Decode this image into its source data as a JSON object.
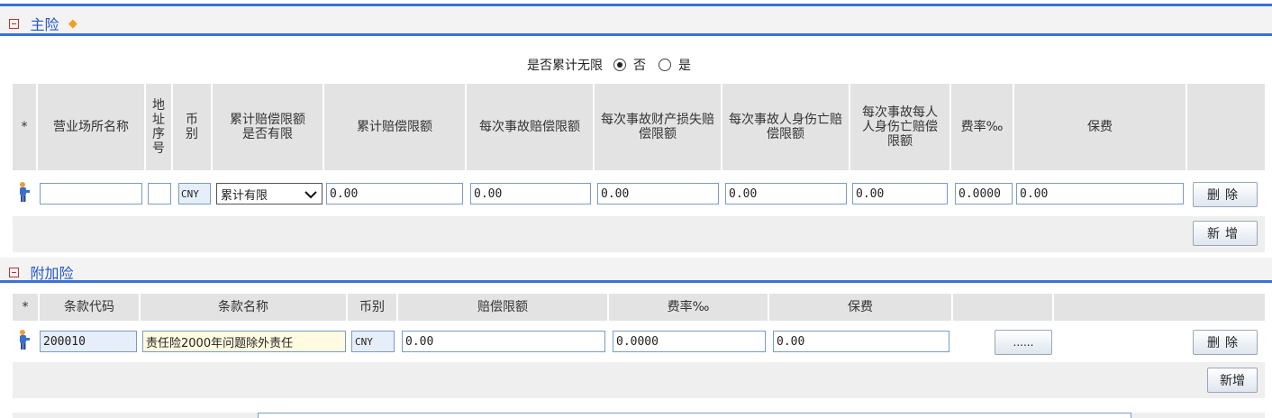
{
  "main": {
    "title": "主险",
    "marker": "◆",
    "cumulative_label": "是否累计无限",
    "radio_no": "否",
    "radio_yes": "是",
    "headers": {
      "star": "*",
      "place_name": "营业场所名称",
      "addr_seq": "地址序号",
      "currency": "币别",
      "cum_limit_flag": "累计赔偿限额是否有限",
      "cum_limit": "累计赔偿限额",
      "per_accident": "每次事故赔偿限额",
      "per_property": "每次事故财产损失赔偿限额",
      "per_injury": "每次事故人身伤亡赔偿限额",
      "per_person": "每次事故每人人身伤亡赔偿限额",
      "rate": "费率‰",
      "premium": "保费"
    },
    "row": {
      "place_name": "",
      "addr_seq": "",
      "currency": "CNY",
      "cum_limit_flag": "累计有限",
      "cum_limit": "0.00",
      "per_accident": "0.00",
      "per_property": "0.00",
      "per_injury": "0.00",
      "per_person": "0.00",
      "rate": "0.0000",
      "premium": "0.00"
    },
    "delete_label": "删除",
    "add_label": "新增"
  },
  "addl": {
    "title": "附加险",
    "headers": {
      "star": "*",
      "clause_code": "条款代码",
      "clause_name": "条款名称",
      "currency": "币别",
      "limit": "赔偿限额",
      "rate": "费率‰",
      "premium": "保费"
    },
    "row": {
      "clause_code": "200010",
      "clause_name": "责任险2000年问题除外责任",
      "currency": "CNY",
      "limit": "0.00",
      "rate": "0.0000",
      "premium": "0.00"
    },
    "more_label": "......",
    "delete_label": "删除",
    "add_label": "新增"
  },
  "colors": {
    "accent": "#3b6fd8",
    "header_bg": "#e3e3e3",
    "input_border": "#7a9cc4",
    "title_text": "#2255cc"
  },
  "icons": [
    "collapse-icon",
    "person-icon",
    "chevron-down-icon"
  ]
}
